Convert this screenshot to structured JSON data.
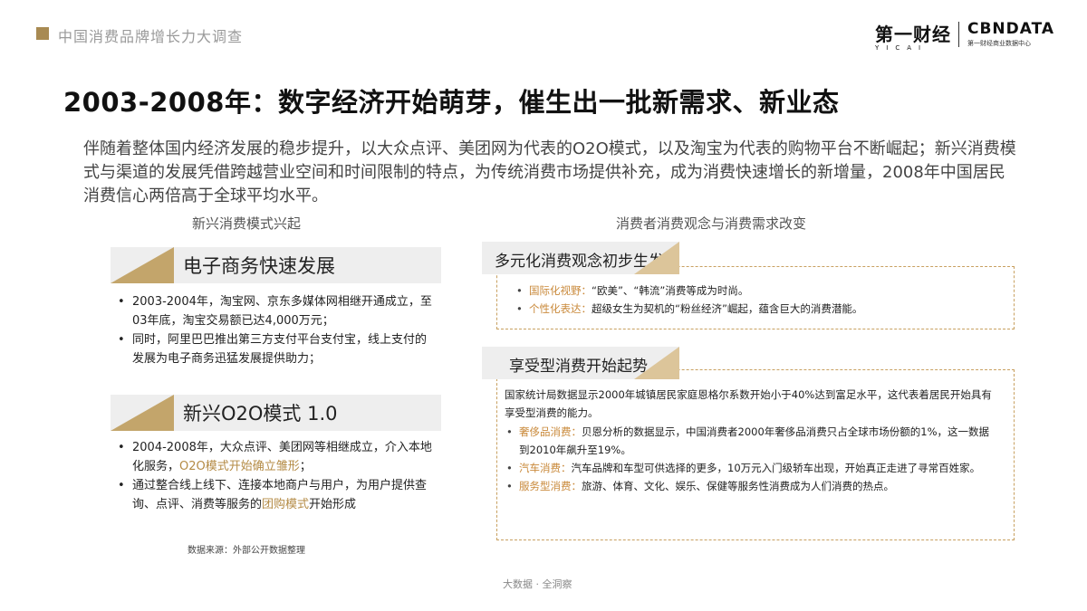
{
  "header": {
    "report_name": "中国消费品牌增长力大调查",
    "logo_yicai_cn": "第一财经",
    "logo_yicai_en": "YICAI",
    "logo_cbn": "CBNDATA",
    "logo_cbn_sub": "第一财经商业数据中心"
  },
  "title": "2003-2008年：数字经济开始萌芽，催生出一批新需求、新业态",
  "intro": "伴随着整体国内经济发展的稳步提升，以大众点评、美团网为代表的O2O模式，以及淘宝为代表的购物平台不断崛起；新兴消费模式与渠道的发展凭借跨越营业空间和时间限制的特点，为传统消费市场提供补充，成为消费快速增长的新增量，2008年中国居民消费信心两倍高于全球平均水平。",
  "left": {
    "heading": "新兴消费模式兴起",
    "section1": {
      "title": "电子商务快速发展",
      "b1": "2003-2004年，淘宝网、京东多媒体网相继开通成立，至03年底，淘宝交易额已达4,000万元；",
      "b2": "同时，阿里巴巴推出第三方支付平台支付宝，线上支付的发展为电子商务迅猛发展提供助力；"
    },
    "section2": {
      "title": "新兴O2O模式 1.0",
      "b1_pre": "2004-2008年，大众点评、美团网等相继成立，介入本地化服务，",
      "b1_hl": "O2O模式开始确立雏形",
      "b1_post": "；",
      "b2_pre": "通过整合线上线下、连接本地商户与用户，为用户提供查询、点评、消费等服务的",
      "b2_hl": "团购模式",
      "b2_post": "开始形成"
    },
    "source": "数据来源：外部公开数据整理"
  },
  "right": {
    "heading": "消费者消费观念与消费需求改变",
    "section1": {
      "title": "多元化消费观念初步生发",
      "b1_label": "国际化视野：",
      "b1_text": "“欧美”、“韩流”消费等成为时尚。",
      "b2_label": "个性化表达：",
      "b2_text": "超级女生为契机的“粉丝经济”崛起，蕴含巨大的消费潜能。"
    },
    "section2": {
      "title": "享受型消费开始起势",
      "para": "国家统计局数据显示2000年城镇居民家庭恩格尔系数开始小于40%达到富足水平，这代表着居民开始具有享受型消费的能力。",
      "b1_label": "奢侈品消费：",
      "b1_text": "贝恩分析的数据显示，中国消费者2000年奢侈品消费只占全球市场份额的1%，这一数据到2010年飙升至19%。",
      "b2_label": "汽车消费：",
      "b2_text": "汽车品牌和车型可供选择的更多，10万元入门级轿车出现，开始真正走进了寻常百姓家。",
      "b3_label": "服务型消费：",
      "b3_text": "旅游、体育、文化、娱乐、保健等服务性消费成为人们消费的热点。"
    }
  },
  "footer": "大数据 · 全洞察"
}
